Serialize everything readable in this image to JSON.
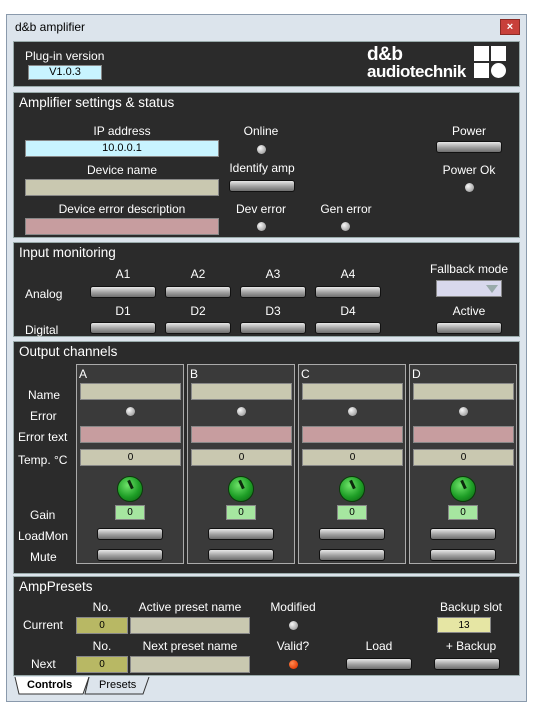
{
  "window": {
    "title": "d&b amplifier",
    "close_label": "×"
  },
  "plugin": {
    "label": "Plug-in version",
    "version": "V1.0.3",
    "logo_line1": "d&b",
    "logo_line2": "audiotechnik"
  },
  "amp": {
    "title": "Amplifier settings & status",
    "ip_label": "IP address",
    "ip_value": "10.0.0.1",
    "device_name_label": "Device name",
    "device_name_value": "",
    "device_error_label": "Device error description",
    "device_error_value": "",
    "online_label": "Online",
    "identify_label": "Identify amp",
    "dev_error_label": "Dev error",
    "gen_error_label": "Gen error",
    "power_label": "Power",
    "power_ok_label": "Power Ok"
  },
  "input": {
    "title": "Input monitoring",
    "analog_label": "Analog",
    "digital_label": "Digital",
    "analog": [
      "A1",
      "A2",
      "A3",
      "A4"
    ],
    "digital": [
      "D1",
      "D2",
      "D3",
      "D4"
    ],
    "fallback_label": "Fallback mode",
    "active_label": "Active"
  },
  "output": {
    "title": "Output channels",
    "row_labels": {
      "name": "Name",
      "error": "Error",
      "error_text": "Error text",
      "temp": "Temp. °C",
      "gain": "Gain",
      "loadmon": "LoadMon",
      "mute": "Mute"
    },
    "channels": [
      {
        "id": "A",
        "temp": "0",
        "gain": "0"
      },
      {
        "id": "B",
        "temp": "0",
        "gain": "0"
      },
      {
        "id": "C",
        "temp": "0",
        "gain": "0"
      },
      {
        "id": "D",
        "temp": "0",
        "gain": "0"
      }
    ]
  },
  "presets": {
    "title": "AmpPresets",
    "current_label": "Current",
    "next_label": "Next",
    "no_label": "No.",
    "active_name_label": "Active preset name",
    "next_name_label": "Next preset name",
    "modified_label": "Modified",
    "valid_label": "Valid?",
    "load_label": "Load",
    "backup_slot_label": "Backup slot",
    "backup_slot_value": "13",
    "add_backup_label": "+ Backup",
    "current_no": "0",
    "next_no": "0",
    "active_name": "",
    "next_name": ""
  },
  "tabs": [
    "Controls",
    "Presets"
  ],
  "colors": {
    "panel_bg": "#2b2b2b",
    "valid_led": "#e8430c",
    "knob": "#1e9e26"
  }
}
